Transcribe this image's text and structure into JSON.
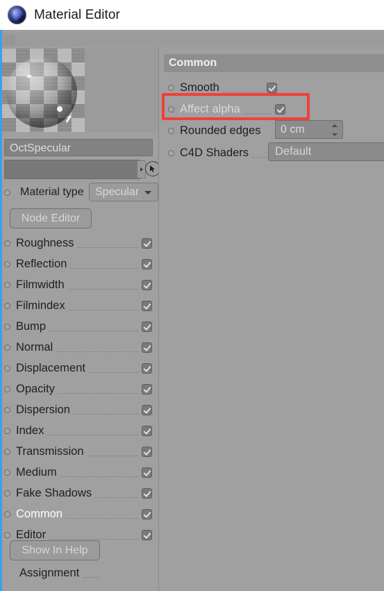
{
  "window": {
    "title": "Material Editor",
    "logo_icon": "cinema4d-logo-icon",
    "grip_icon": "drag-grip-icon"
  },
  "preview": {
    "name": "material-preview-sphere-on-checkerboard"
  },
  "fields": {
    "material_name": "OctSpecular",
    "link_field_value": "",
    "link_arrow_icon": "expand-arrow-icon",
    "picker_icon": "pick-cursor-icon"
  },
  "material_type": {
    "label": "Material type",
    "value": "Specular",
    "chevron_icon": "chevron-down-icon"
  },
  "buttons": {
    "node_editor": "Node Editor",
    "show_in_help": "Show In Help"
  },
  "channels": [
    {
      "label": "Roughness",
      "checked": true,
      "selected": false
    },
    {
      "label": "Reflection",
      "checked": true,
      "selected": false
    },
    {
      "label": "Filmwidth",
      "checked": true,
      "selected": false
    },
    {
      "label": "Filmindex",
      "checked": true,
      "selected": false
    },
    {
      "label": "Bump",
      "checked": true,
      "selected": false
    },
    {
      "label": "Normal",
      "checked": true,
      "selected": false
    },
    {
      "label": "Displacement",
      "checked": true,
      "selected": false
    },
    {
      "label": "Opacity",
      "checked": true,
      "selected": false
    },
    {
      "label": "Dispersion",
      "checked": true,
      "selected": false
    },
    {
      "label": "Index",
      "checked": true,
      "selected": false
    },
    {
      "label": "Transmission",
      "checked": true,
      "selected": false
    },
    {
      "label": "Medium",
      "checked": true,
      "selected": false
    },
    {
      "label": "Fake Shadows",
      "checked": true,
      "selected": false
    },
    {
      "label": "Common",
      "checked": true,
      "selected": true
    },
    {
      "label": "Editor",
      "checked": true,
      "selected": false
    }
  ],
  "assignment": {
    "label": "Assignment"
  },
  "common_panel": {
    "header": "Common",
    "rows": [
      {
        "label": "Smooth",
        "control": "checkbox",
        "checked": true
      },
      {
        "label": "Affect alpha",
        "control": "checkbox",
        "checked": true,
        "highlighted": true
      },
      {
        "label": "Rounded edges",
        "control": "spinner",
        "value": "0 cm"
      },
      {
        "label": "C4D Shaders",
        "control": "text",
        "value": "Default"
      }
    ]
  },
  "highlight": {
    "color": "#ef4136",
    "target": "Affect alpha"
  },
  "colors": {
    "panel_bg": "#a0a0a0",
    "titlebar_bg": "#ffffff",
    "accent_border": "#3aa0e8",
    "section_header_bg": "#8e8e8e",
    "field_bg": "#8b8b8b",
    "text_dark": "#1e1e1e",
    "text_light": "#d8d8d8"
  }
}
